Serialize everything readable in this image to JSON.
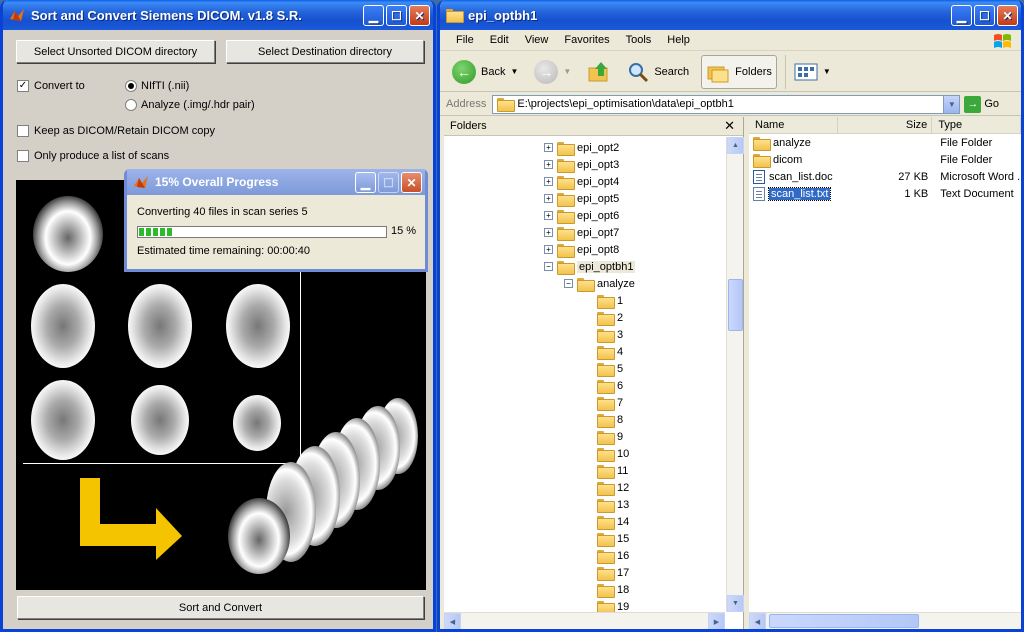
{
  "left_window": {
    "title": "Sort and Convert Siemens DICOM.  v1.8 S.R.",
    "btn_select_unsorted": "Select Unsorted DICOM directory",
    "btn_select_dest": "Select Destination directory",
    "convert_to_label": "Convert to",
    "radio_nifti": "NIfTI (.nii)",
    "radio_analyze": "Analyze (.img/.hdr pair)",
    "keep_dicom_label": "Keep as DICOM/Retain DICOM copy",
    "only_list_label": "Only produce a list of scans",
    "btn_sort_convert": "Sort and Convert",
    "convert_checked": "✓",
    "arrow_color": "#f5c400"
  },
  "progress_dialog": {
    "title": "15%  Overall Progress",
    "message": "Converting 40 files in scan series 5",
    "percent_label": "15 %",
    "progress": 0.15,
    "eta": "Estimated time remaining:   00:00:40"
  },
  "explorer": {
    "title": "epi_optbh1",
    "menu": [
      "File",
      "Edit",
      "View",
      "Favorites",
      "Tools",
      "Help"
    ],
    "toolbar": {
      "back": "Back",
      "search": "Search",
      "folders": "Folders"
    },
    "address_label": "Address",
    "address_value": "E:\\projects\\epi_optimisation\\data\\epi_optbh1",
    "go_label": "Go",
    "folders_pane_title": "Folders",
    "tree": [
      {
        "label": "epi_opt2",
        "depth": 0,
        "toggle": "+"
      },
      {
        "label": "epi_opt3",
        "depth": 0,
        "toggle": "+"
      },
      {
        "label": "epi_opt4",
        "depth": 0,
        "toggle": "+"
      },
      {
        "label": "epi_opt5",
        "depth": 0,
        "toggle": "+"
      },
      {
        "label": "epi_opt6",
        "depth": 0,
        "toggle": "+"
      },
      {
        "label": "epi_opt7",
        "depth": 0,
        "toggle": "+"
      },
      {
        "label": "epi_opt8",
        "depth": 0,
        "toggle": "+"
      },
      {
        "label": "epi_optbh1",
        "depth": 0,
        "toggle": "−",
        "selected": true
      },
      {
        "label": "analyze",
        "depth": 1,
        "toggle": "−"
      },
      {
        "label": "1",
        "depth": 2,
        "toggle": ""
      },
      {
        "label": "2",
        "depth": 2,
        "toggle": ""
      },
      {
        "label": "3",
        "depth": 2,
        "toggle": ""
      },
      {
        "label": "4",
        "depth": 2,
        "toggle": ""
      },
      {
        "label": "5",
        "depth": 2,
        "toggle": ""
      },
      {
        "label": "6",
        "depth": 2,
        "toggle": ""
      },
      {
        "label": "7",
        "depth": 2,
        "toggle": ""
      },
      {
        "label": "8",
        "depth": 2,
        "toggle": ""
      },
      {
        "label": "9",
        "depth": 2,
        "toggle": ""
      },
      {
        "label": "10",
        "depth": 2,
        "toggle": ""
      },
      {
        "label": "11",
        "depth": 2,
        "toggle": ""
      },
      {
        "label": "12",
        "depth": 2,
        "toggle": ""
      },
      {
        "label": "13",
        "depth": 2,
        "toggle": ""
      },
      {
        "label": "14",
        "depth": 2,
        "toggle": ""
      },
      {
        "label": "15",
        "depth": 2,
        "toggle": ""
      },
      {
        "label": "16",
        "depth": 2,
        "toggle": ""
      },
      {
        "label": "17",
        "depth": 2,
        "toggle": ""
      },
      {
        "label": "18",
        "depth": 2,
        "toggle": ""
      },
      {
        "label": "19",
        "depth": 2,
        "toggle": ""
      }
    ],
    "columns": [
      "Name",
      "Size",
      "Type"
    ],
    "files": [
      {
        "name": "analyze",
        "size": "",
        "type": "File Folder",
        "kind": "folder"
      },
      {
        "name": "dicom",
        "size": "",
        "type": "File Folder",
        "kind": "folder"
      },
      {
        "name": "scan_list.doc",
        "size": "27 KB",
        "type": "Microsoft Word ...",
        "kind": "doc"
      },
      {
        "name": "scan_list.txt",
        "size": "1 KB",
        "type": "Text Document",
        "kind": "txt",
        "selected": true
      }
    ]
  }
}
